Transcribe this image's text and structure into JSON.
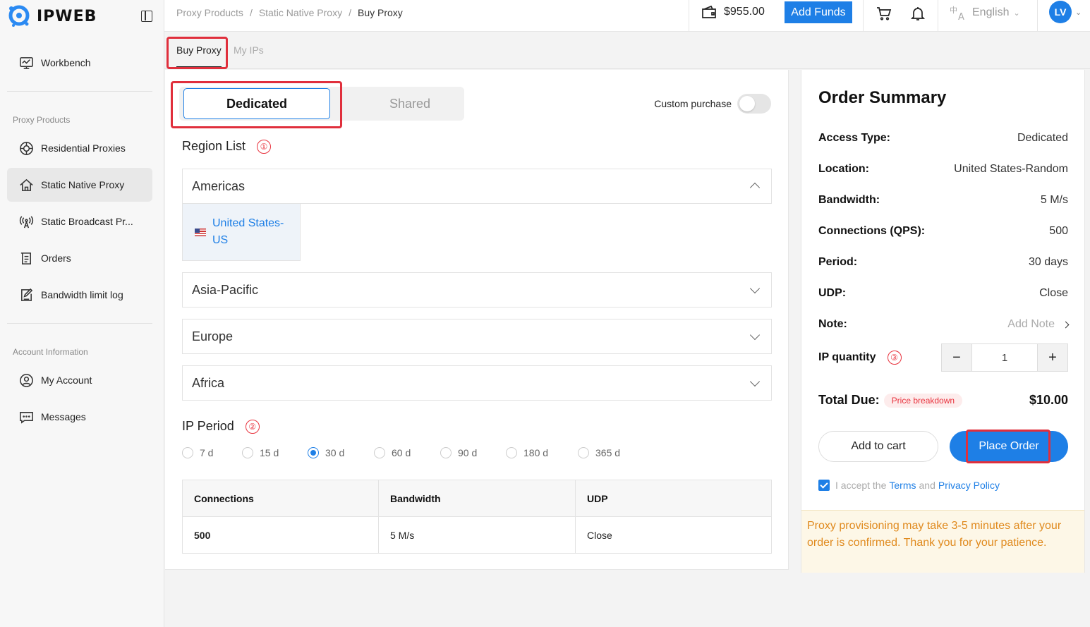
{
  "brand": {
    "name": "IPWEB"
  },
  "sidebar": {
    "items": [
      {
        "label": "Workbench",
        "icon": "monitor-icon"
      },
      {
        "label": "Residential Proxies",
        "icon": "globe-icon"
      },
      {
        "label": "Static Native Proxy",
        "icon": "home-icon"
      },
      {
        "label": "Static Broadcast Pr...",
        "icon": "broadcast-icon"
      },
      {
        "label": "Orders",
        "icon": "orders-icon"
      },
      {
        "label": "Bandwidth limit log",
        "icon": "edit-log-icon"
      },
      {
        "label": "My Account",
        "icon": "user-icon"
      },
      {
        "label": "Messages",
        "icon": "message-icon"
      }
    ],
    "sections": {
      "proxy_products": "Proxy Products",
      "account_information": "Account Information"
    }
  },
  "header": {
    "breadcrumb": [
      "Proxy Products",
      "Static Native Proxy",
      "Buy Proxy"
    ],
    "balance": "$955.00",
    "add_funds": "Add Funds",
    "language": "English",
    "avatar_initials": "LV"
  },
  "tabs": [
    "Buy Proxy",
    "My IPs"
  ],
  "purchase": {
    "type_options": [
      "Dedicated",
      "Shared"
    ],
    "custom_purchase_label": "Custom purchase",
    "region_list_title": "Region List",
    "region_list_marker": "①",
    "regions": [
      "Americas",
      "Asia-Pacific",
      "Europe",
      "Africa"
    ],
    "country": "United States-US",
    "ip_period_title": "IP Period",
    "ip_period_marker": "②",
    "periods": [
      "7 d",
      "15 d",
      "30 d",
      "60 d",
      "90 d",
      "180 d",
      "365 d"
    ],
    "selected_period": "30 d",
    "table": {
      "headers": [
        "Connections",
        "Bandwidth",
        "UDP"
      ],
      "row": [
        "500",
        "5 M/s",
        "Close"
      ]
    }
  },
  "summary": {
    "title": "Order Summary",
    "rows": [
      {
        "k": "Access Type:",
        "v": "Dedicated"
      },
      {
        "k": "Location:",
        "v": "United States-Random"
      },
      {
        "k": "Bandwidth:",
        "v": "5 M/s"
      },
      {
        "k": "Connections (QPS):",
        "v": "500"
      },
      {
        "k": "Period:",
        "v": "30 days"
      },
      {
        "k": "UDP:",
        "v": "Close"
      }
    ],
    "note_label": "Note:",
    "note_value": "Add Note",
    "ip_quantity_label": "IP quantity",
    "ip_quantity_marker": "③",
    "quantity": "1",
    "total_label": "Total Due:",
    "price_breakdown": "Price breakdown",
    "total": "$10.00",
    "add_to_cart": "Add to cart",
    "place_order": "Place Order",
    "terms_prefix": "I accept the",
    "terms_link": "Terms",
    "terms_and": "and",
    "privacy_link": "Privacy Policy",
    "notice": "Proxy provisioning may take 3-5 minutes after your order is confirmed. Thank you for your patience."
  },
  "colors": {
    "accent": "#1e7fe6",
    "highlight": "#e02f3c",
    "notice_text": "#e08a1e"
  }
}
